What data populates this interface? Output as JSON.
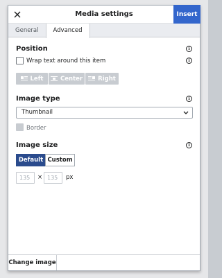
{
  "dialog": {
    "title": "Media settings",
    "insert_label": "Insert",
    "close_icon": "close-icon"
  },
  "tabs": [
    {
      "label": "General",
      "active": false
    },
    {
      "label": "Advanced",
      "active": true
    }
  ],
  "position": {
    "title": "Position",
    "wrap_label": "Wrap text around this item",
    "wrap_checked": false,
    "align_buttons": [
      {
        "label": "Left",
        "icon": "align-left-icon"
      },
      {
        "label": "Center",
        "icon": "align-center-icon"
      },
      {
        "label": "Right",
        "icon": "align-right-icon"
      }
    ]
  },
  "image_type": {
    "title": "Image type",
    "selected": "Thumbnail",
    "border_label": "Border",
    "border_checked": false
  },
  "image_size": {
    "title": "Image size",
    "default_label": "Default",
    "custom_label": "Custom",
    "width_placeholder": "135",
    "height_placeholder": "135",
    "times": "×",
    "unit": "px"
  },
  "footer": {
    "change_image_label": "Change image"
  },
  "colors": {
    "accent": "#3366cc",
    "active_toggle": "#2a4b8d",
    "disabled": "#c8ccd1"
  }
}
